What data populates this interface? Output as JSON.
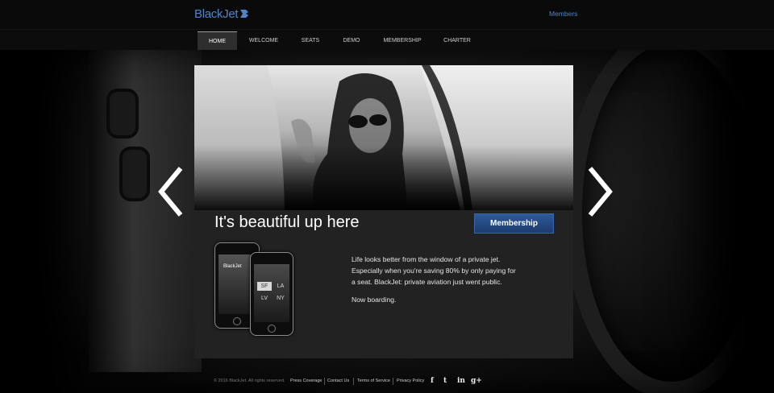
{
  "header": {
    "logo_text": "BlackJet",
    "members_label": "Members",
    "brand_color": "#4f84c9"
  },
  "nav": {
    "items": [
      {
        "label": "HOME",
        "active": true
      },
      {
        "label": "WELCOME"
      },
      {
        "label": "SEATS"
      },
      {
        "label": "DEMO"
      },
      {
        "label": "MEMBERSHIP"
      },
      {
        "label": "CHARTER"
      }
    ]
  },
  "slider": {
    "prev_icon": "chevron-left-icon",
    "next_icon": "chevron-right-icon"
  },
  "main": {
    "headline": "It's beautiful up here",
    "button_label": "Membership",
    "paragraph_1": "Life looks better from the window of a private jet. Especially when you're saving 80% by only paying for a seat. BlackJet: private aviation just went public.",
    "paragraph_2": "Now boarding.",
    "phone": {
      "logo": "BlackJet",
      "cities": [
        "SF",
        "LA",
        "LV",
        "NY"
      ]
    }
  },
  "footer": {
    "copyright": "© 2016 BlackJet. All rights reserved.",
    "links": [
      "Press Coverage",
      "Contact Us",
      "Terms of Service",
      "Privacy Policy"
    ],
    "social": [
      {
        "icon": "facebook-icon",
        "glyph": "f"
      },
      {
        "icon": "twitter-icon",
        "glyph": "t"
      },
      {
        "icon": "linkedin-icon",
        "glyph": "in"
      },
      {
        "icon": "google-plus-icon",
        "glyph": "g+"
      }
    ]
  }
}
